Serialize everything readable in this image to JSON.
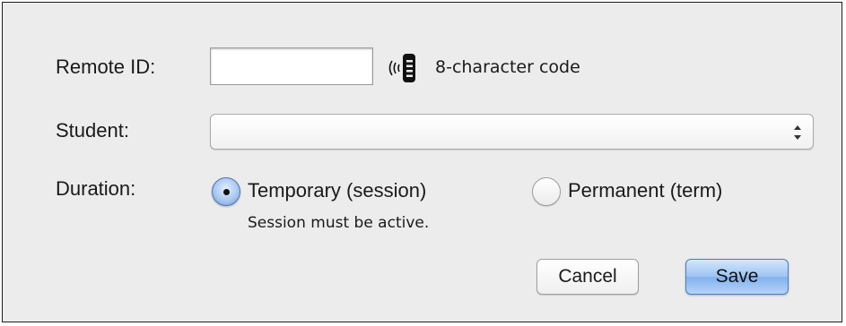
{
  "form": {
    "remote_id": {
      "label": "Remote ID:",
      "value": "",
      "hint": "8-character code"
    },
    "student": {
      "label": "Student:",
      "selected": ""
    },
    "duration": {
      "label": "Duration:",
      "options": [
        {
          "label": "Temporary (session)",
          "selected": true
        },
        {
          "label": "Permanent (term)",
          "selected": false
        }
      ],
      "note": "Session must be active."
    }
  },
  "buttons": {
    "cancel_label": "Cancel",
    "save_label": "Save"
  },
  "icons": {
    "rf_icon": "rfid-remote-icon",
    "select_arrows": "up-down-chevron-icon"
  },
  "colors": {
    "dialog_background": "#ececec",
    "default_button": "#9cc3f2",
    "radio_selected": "#a9c8f0"
  }
}
